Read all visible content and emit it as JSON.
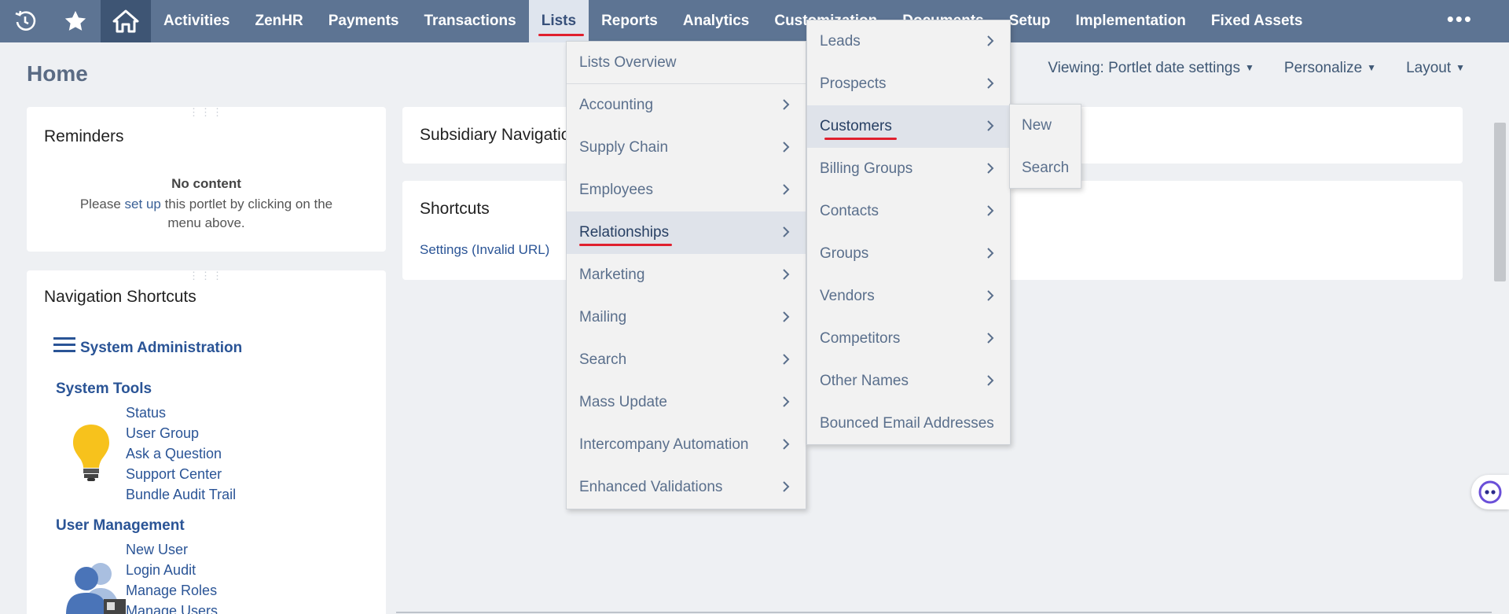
{
  "topnav": {
    "icons": [
      "history-icon",
      "star-icon",
      "home-icon"
    ],
    "items": [
      "Activities",
      "ZenHR",
      "Payments",
      "Transactions",
      "Lists",
      "Reports",
      "Analytics",
      "Customization",
      "Documents",
      "Setup",
      "Implementation",
      "Fixed Assets"
    ],
    "active": "Lists",
    "more_label": "•••"
  },
  "page": {
    "title": "Home",
    "actions": {
      "viewing": "Viewing: Portlet date settings",
      "personalize": "Personalize",
      "layout": "Layout"
    }
  },
  "reminders": {
    "title": "Reminders",
    "no_content": "No content",
    "msg_before": "Please ",
    "msg_link": "set up",
    "msg_after": " this portlet by clicking on the menu above."
  },
  "nav_shortcuts": {
    "title": "Navigation Shortcuts",
    "group": "System Administration",
    "sections": [
      {
        "heading": "System Tools",
        "links": [
          "Status",
          "User Group",
          "Ask a Question",
          "Support Center",
          "Bundle Audit Trail"
        ]
      },
      {
        "heading": "User Management",
        "links": [
          "New User",
          "Login Audit",
          "Manage Roles",
          "Manage Users"
        ]
      }
    ]
  },
  "subsidiary_nav": {
    "title": "Subsidiary Navigation"
  },
  "shortcuts": {
    "title": "Shortcuts",
    "link": "Settings (Invalid URL)"
  },
  "lists_menu": {
    "items": [
      "Lists Overview",
      "Accounting",
      "Supply Chain",
      "Employees",
      "Relationships",
      "Marketing",
      "Mailing",
      "Search",
      "Mass Update",
      "Intercompany Automation",
      "Enhanced Validations"
    ],
    "highlighted": "Relationships"
  },
  "relationships_menu": {
    "items": [
      "Leads",
      "Prospects",
      "Customers",
      "Billing Groups",
      "Contacts",
      "Groups",
      "Vendors",
      "Competitors",
      "Other Names",
      "Bounced Email Addresses"
    ],
    "highlighted": "Customers"
  },
  "customers_menu": {
    "items": [
      "New",
      "Search"
    ]
  },
  "colors": {
    "nav_bg": "#5d7493",
    "home_bg": "#3e5574",
    "link": "#2a5496",
    "underline": "#e0202e"
  }
}
